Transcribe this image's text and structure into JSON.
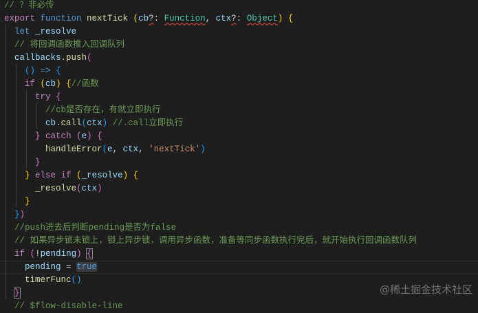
{
  "editor": {
    "lines": [
      [
        [
          "// ？非必传",
          "cm"
        ]
      ],
      [
        [
          "export ",
          "ctl"
        ],
        [
          "function ",
          "kw"
        ],
        [
          "nextTick ",
          "fn"
        ],
        [
          "(",
          "b1"
        ],
        [
          "cb",
          "var"
        ],
        [
          "?",
          "err p"
        ],
        [
          ": ",
          "p"
        ],
        [
          "Function",
          "ty err"
        ],
        [
          ", ",
          "p"
        ],
        [
          "ctx",
          "var"
        ],
        [
          "?",
          "err p"
        ],
        [
          ": ",
          "p"
        ],
        [
          "Object",
          "ty err"
        ],
        [
          ")",
          "b1"
        ],
        [
          " ",
          "p"
        ],
        [
          "{",
          "b1"
        ]
      ],
      [
        [
          "  ",
          "p"
        ],
        [
          "let ",
          "kw"
        ],
        [
          "_resolve",
          "var"
        ]
      ],
      [
        [
          "  ",
          "p"
        ],
        [
          "// 将回调函数推入回调队列",
          "cm"
        ]
      ],
      [
        [
          "  ",
          "p"
        ],
        [
          "callbacks",
          "var"
        ],
        [
          ".",
          "p"
        ],
        [
          "push",
          "fn"
        ],
        [
          "(",
          "b2"
        ]
      ],
      [
        [
          "    ",
          "p"
        ],
        [
          "()",
          "b3"
        ],
        [
          " => ",
          "kw"
        ],
        [
          "{",
          "b3"
        ]
      ],
      [
        [
          "    ",
          "p"
        ],
        [
          "if ",
          "ctl"
        ],
        [
          "(",
          "b1"
        ],
        [
          "cb",
          "var"
        ],
        [
          ")",
          "b1"
        ],
        [
          " ",
          "p"
        ],
        [
          "{",
          "b1"
        ],
        [
          "//函数",
          "cm"
        ]
      ],
      [
        [
          "      ",
          "p"
        ],
        [
          "try ",
          "ctl"
        ],
        [
          "{",
          "b2"
        ]
      ],
      [
        [
          "        ",
          "p"
        ],
        [
          "//cb是否存在，有就立即执行",
          "cm"
        ]
      ],
      [
        [
          "        ",
          "p"
        ],
        [
          "cb",
          "var"
        ],
        [
          ".",
          "p"
        ],
        [
          "call",
          "fn"
        ],
        [
          "(",
          "b3"
        ],
        [
          "ctx",
          "var"
        ],
        [
          ")",
          "b3"
        ],
        [
          " ",
          "p"
        ],
        [
          "//.call立即执行",
          "cm"
        ]
      ],
      [
        [
          "      ",
          "p"
        ],
        [
          "}",
          "b2"
        ],
        [
          " catch ",
          "ctl"
        ],
        [
          "(",
          "b2"
        ],
        [
          "e",
          "var"
        ],
        [
          ")",
          "b2"
        ],
        [
          " ",
          "p"
        ],
        [
          "{",
          "b2"
        ]
      ],
      [
        [
          "        ",
          "p"
        ],
        [
          "handleError",
          "fn"
        ],
        [
          "(",
          "b3"
        ],
        [
          "e",
          "var"
        ],
        [
          ", ",
          "p"
        ],
        [
          "ctx",
          "var"
        ],
        [
          ", ",
          "p"
        ],
        [
          "'nextTick'",
          "str"
        ],
        [
          ")",
          "b3"
        ]
      ],
      [
        [
          "      ",
          "p"
        ],
        [
          "}",
          "b2"
        ]
      ],
      [
        [
          "    ",
          "p"
        ],
        [
          "}",
          "b1"
        ],
        [
          " else if ",
          "ctl"
        ],
        [
          "(",
          "b1"
        ],
        [
          "_resolve",
          "var"
        ],
        [
          ")",
          "b1"
        ],
        [
          " ",
          "p"
        ],
        [
          "{",
          "b1"
        ]
      ],
      [
        [
          "      ",
          "p"
        ],
        [
          "_resolve",
          "fn"
        ],
        [
          "(",
          "b2"
        ],
        [
          "ctx",
          "var"
        ],
        [
          ")",
          "b2"
        ]
      ],
      [
        [
          "    ",
          "p"
        ],
        [
          "}",
          "b1"
        ]
      ],
      [
        [
          "  ",
          "p"
        ],
        [
          "}",
          "b3"
        ],
        [
          ")",
          "b2"
        ]
      ],
      [
        [
          "  ",
          "p"
        ],
        [
          "//push进去后判断pending是否为false",
          "cm"
        ]
      ],
      [
        [
          "  ",
          "p"
        ],
        [
          "// 如果异步锁未锁上，锁上异步锁，调用异步函数，准备等同步函数执行完后，就开始执行回调函数队列",
          "cm"
        ]
      ],
      [
        [
          "  ",
          "p"
        ],
        [
          "if ",
          "ctl"
        ],
        [
          "(",
          "b2"
        ],
        [
          "!",
          "p"
        ],
        [
          "pending",
          "var"
        ],
        [
          ")",
          "b2"
        ],
        [
          " ",
          "p"
        ],
        [
          "{",
          "b2 box"
        ]
      ],
      [
        [
          "    ",
          "p"
        ],
        [
          "pending",
          "var"
        ],
        [
          " = ",
          "p"
        ],
        [
          "true",
          "kw sel"
        ]
      ],
      [
        [
          "    ",
          "p"
        ],
        [
          "timerFunc",
          "fn"
        ],
        [
          "()",
          "b3"
        ]
      ],
      [
        [
          "  ",
          "p"
        ],
        [
          "}",
          "b2 box"
        ]
      ],
      [
        [
          "  ",
          "p"
        ],
        [
          "// $flow-disable-line",
          "cm"
        ]
      ]
    ],
    "current_line": 20
  },
  "watermark": "@稀土掘金技术社区"
}
